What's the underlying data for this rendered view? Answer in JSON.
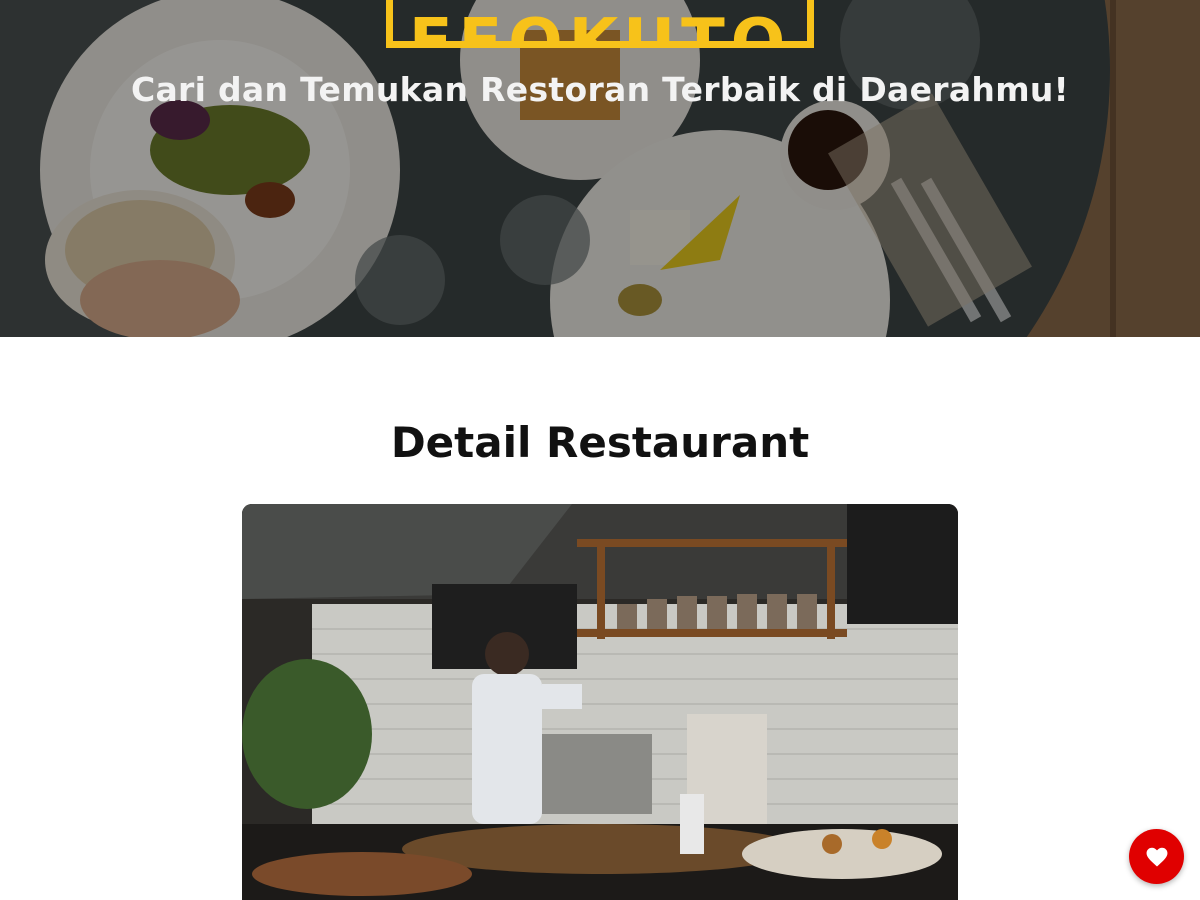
{
  "hero": {
    "brand": "FFOKUTO",
    "tagline": "Cari dan Temukan Restoran Terbaik di Daerahmu!",
    "image": "restaurant-table-top-view-image",
    "brand_color": "#f7c21a"
  },
  "main": {
    "title": "Detail Restaurant",
    "image": "restaurant-kitchen-image"
  },
  "favorite": {
    "icon": "heart-icon",
    "color": "#e00000"
  }
}
